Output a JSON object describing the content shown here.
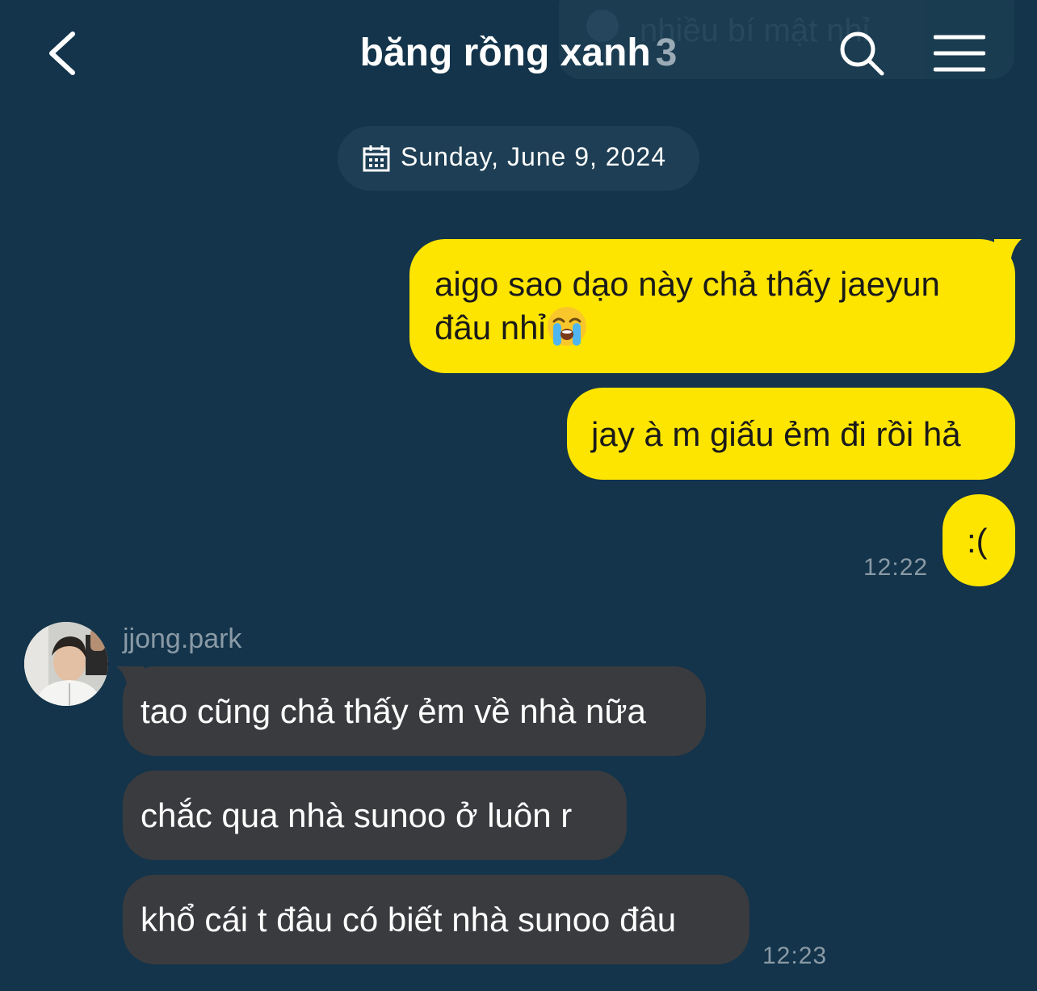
{
  "banner": {
    "ghost_text": "nhiều bí mật nhỉ",
    "ghost_emoji_icon": "smile-emoji-icon"
  },
  "header": {
    "title": "băng rồng xanh",
    "member_count": "3",
    "back_icon": "chevron-left-icon",
    "search_icon": "search-icon",
    "menu_icon": "hamburger-menu-icon"
  },
  "date_divider": {
    "icon": "calendar-icon",
    "text": "Sunday, June 9, 2024"
  },
  "messages_sent": [
    {
      "text": "aigo sao dạo này chả thấy jaeyun đâu nhỉ",
      "emoji": "loudly-crying-face-emoji"
    },
    {
      "text": "jay à m giấu ẻm đi rồi hả"
    },
    {
      "text": ":(",
      "time": "12:22"
    }
  ],
  "messages_received": {
    "sender": "jjong.park",
    "avatar_icon": "profile-avatar",
    "items": [
      {
        "text": "tao cũng chả thấy ẻm về nhà nữa"
      },
      {
        "text": "chắc qua nhà sunoo ở luôn r"
      },
      {
        "text": "khổ cái t đâu có biết nhà sunoo đâu",
        "time": "12:23"
      }
    ]
  },
  "colors": {
    "background": "#13344a",
    "sent_bubble": "#fee500",
    "received_bubble": "#3a3b3f",
    "date_pill": "#1d3e54"
  }
}
